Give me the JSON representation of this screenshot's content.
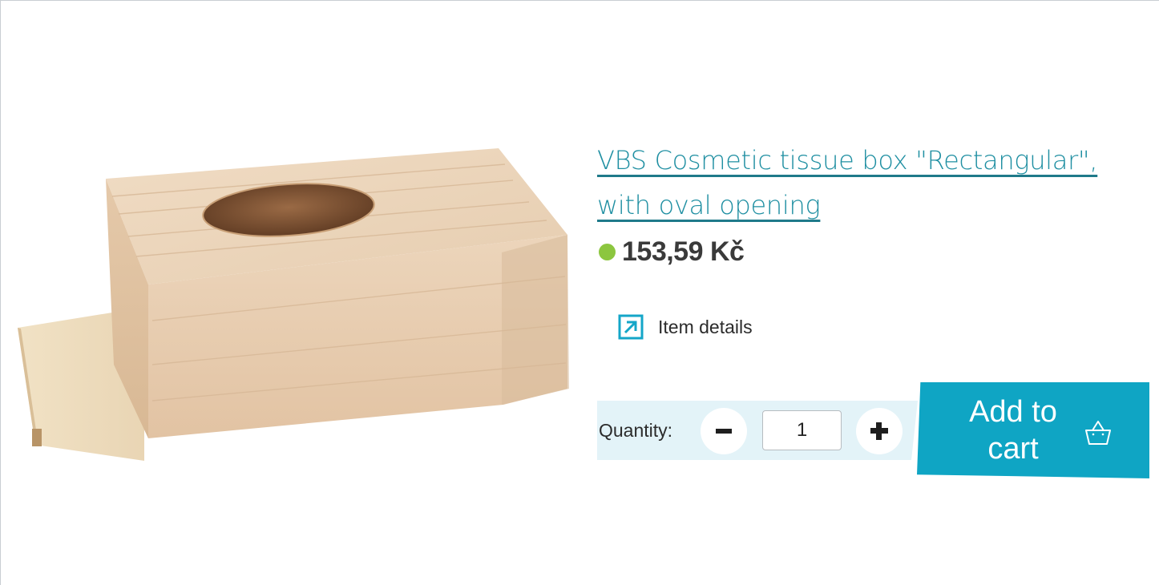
{
  "product": {
    "title": "VBS Cosmetic tissue box \"Rectangular\", with oval opening",
    "price": "153,59 Kč",
    "availability_color": "#8cc63f"
  },
  "details_link": {
    "label": "Item details",
    "icon": "external-arrow-icon"
  },
  "quantity": {
    "label": "Quantity:",
    "value": "1",
    "decrement_icon": "minus-icon",
    "increment_icon": "plus-icon"
  },
  "cart": {
    "label": "Add to cart",
    "icon": "basket-icon",
    "color": "#0fa5c4"
  },
  "colors": {
    "accent": "#1f8fa2",
    "panel": "#e3f3f8"
  }
}
